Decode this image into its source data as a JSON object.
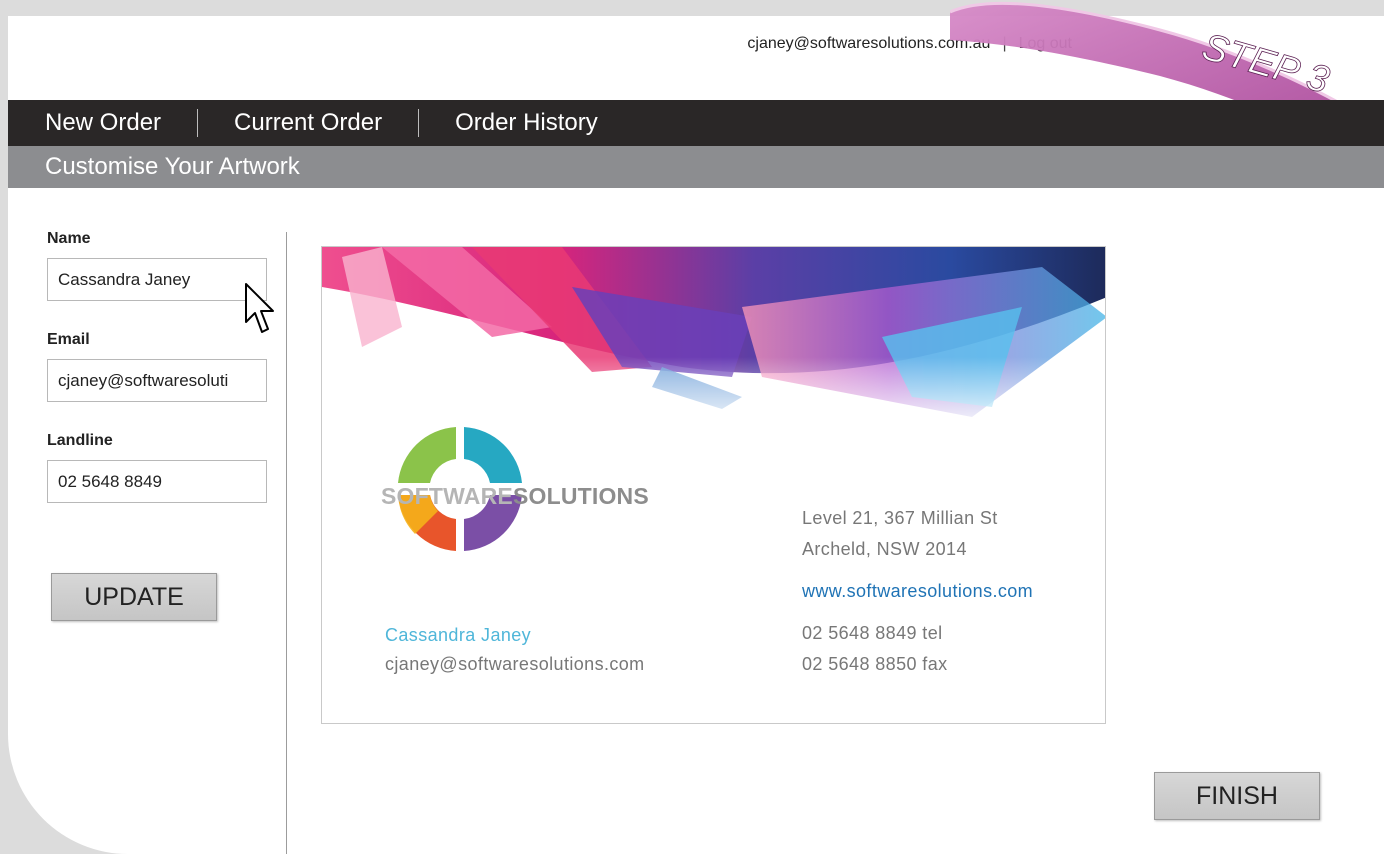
{
  "header": {
    "user_email": "cjaney@softwaresolutions.com.au",
    "separator": "|",
    "logout_label": "Log out"
  },
  "step_ribbon": {
    "text": "STEP 3",
    "color": "#b44fa3"
  },
  "nav": {
    "items": [
      {
        "label": "New Order"
      },
      {
        "label": "Current Order"
      },
      {
        "label": "Order History"
      }
    ]
  },
  "subheader": {
    "title": "Customise Your Artwork"
  },
  "form": {
    "name_label": "Name",
    "name_value": "Cassandra Janey",
    "email_label": "Email",
    "email_value": "cjaney@softwaresoluti",
    "landline_label": "Landline",
    "landline_value": "02 5648 8849",
    "update_label": "UPDATE"
  },
  "card": {
    "logo_text_a": "SOFTWARE",
    "logo_text_b": "SOLUTIONS",
    "address_line1": "Level 21, 367 Millian St",
    "address_line2": "Archeld, NSW 2014",
    "website": "www.softwaresolutions.com",
    "phone_tel": "02 5648 8849 tel",
    "phone_fax": "02 5648 8850 fax",
    "person_name": "Cassandra Janey",
    "person_email": "cjaney@softwaresolutions.com"
  },
  "actions": {
    "finish_label": "FINISH"
  },
  "colors": {
    "nav_bg": "#2a2727",
    "subheader_bg": "#8c8d90",
    "link_blue": "#1f73b5",
    "name_cyan": "#4fb6d9",
    "ribbon": "#b44fa3"
  }
}
